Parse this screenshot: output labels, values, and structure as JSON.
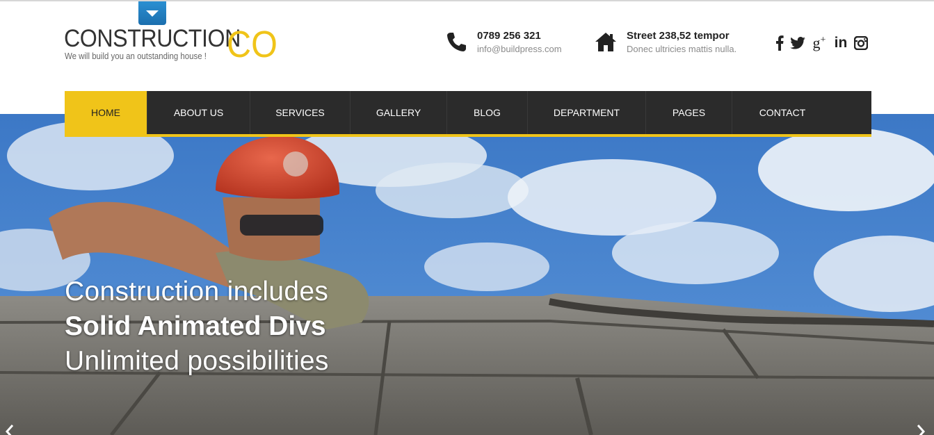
{
  "header": {
    "logo": {
      "main": "CONSTRUCTION",
      "accent": "CO",
      "tagline": "We will build you an outstanding house !"
    },
    "phone": {
      "number": "0789 256 321",
      "email": "info@buildpress.com"
    },
    "address": {
      "street": "Street 238,52 tempor",
      "sub": "Donec ultricies mattis nulla."
    },
    "social": [
      "facebook-icon",
      "twitter-icon",
      "google-plus-icon",
      "linkedin-icon",
      "instagram-icon"
    ]
  },
  "nav": {
    "items": [
      {
        "label": "HOME",
        "active": true
      },
      {
        "label": "ABOUT US",
        "active": false
      },
      {
        "label": "SERVICES",
        "active": false
      },
      {
        "label": "GALLERY",
        "active": false
      },
      {
        "label": "BLOG",
        "active": false
      },
      {
        "label": "DEPARTMENT",
        "active": false
      },
      {
        "label": "PAGES",
        "active": false
      },
      {
        "label": "CONTACT",
        "active": false
      }
    ]
  },
  "hero": {
    "line1": "Construction includes",
    "line2": "Solid Animated Divs",
    "line3": "Unlimited possibilities"
  },
  "colors": {
    "accent": "#f0c419",
    "nav_bg": "#2b2b2b",
    "toggle_blue": "#1c6fae"
  }
}
